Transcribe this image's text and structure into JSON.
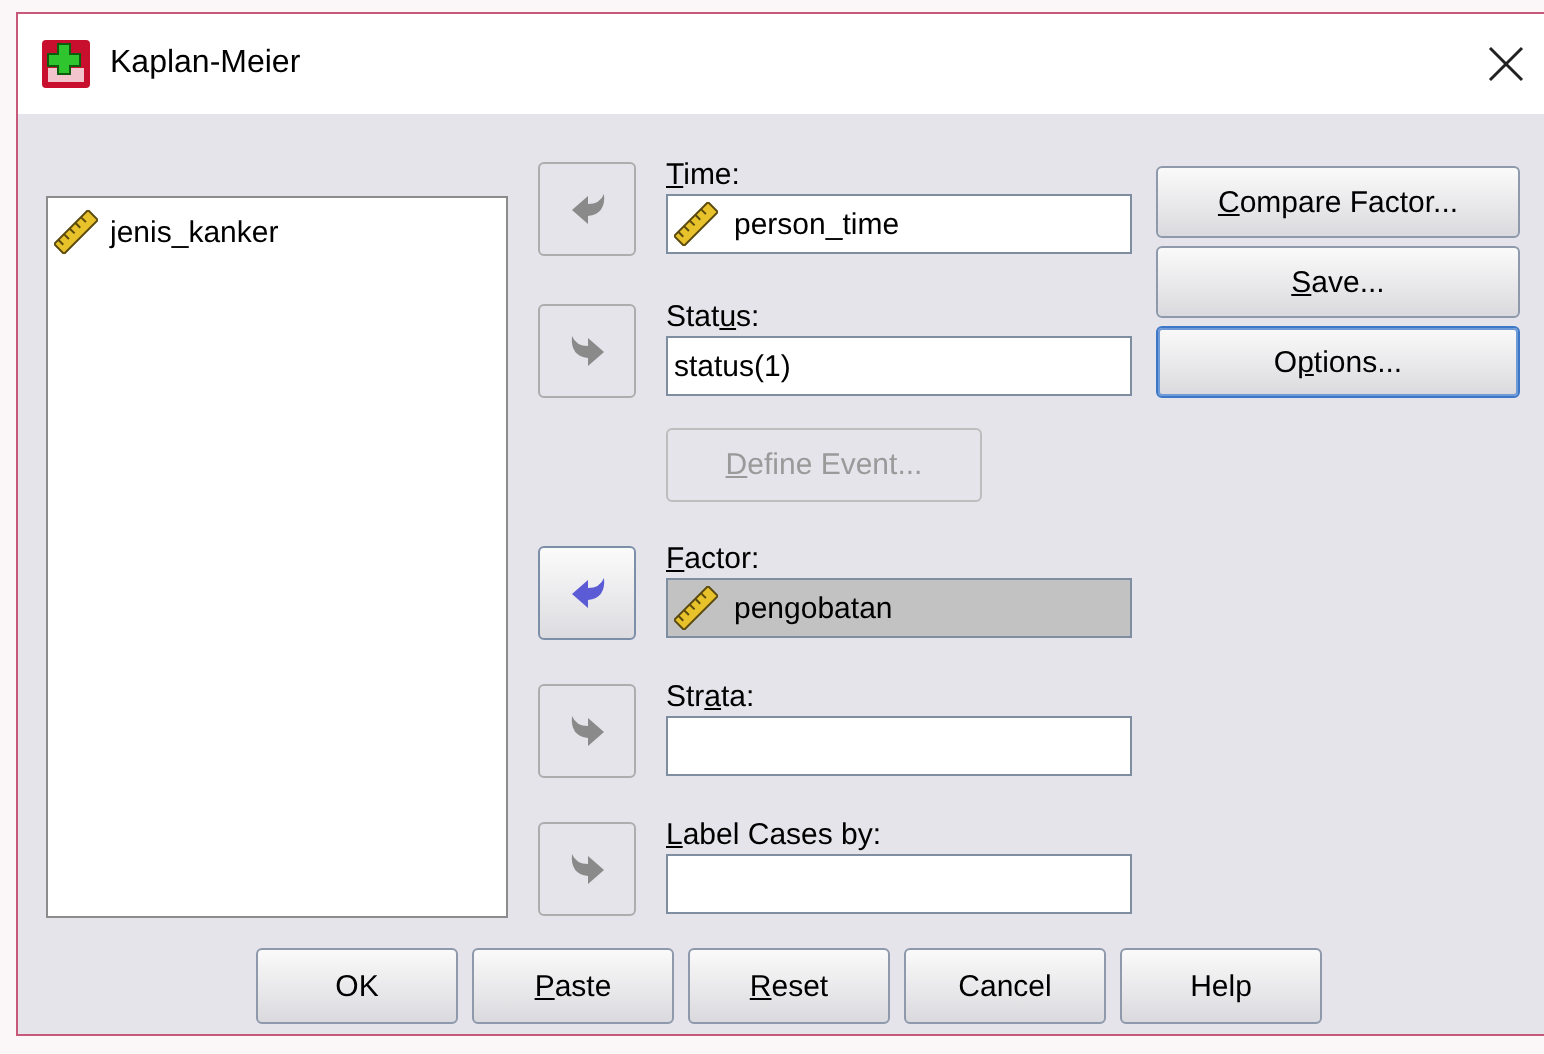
{
  "window": {
    "title": "Kaplan-Meier"
  },
  "source_list": {
    "items": [
      {
        "name": "jenis_kanker",
        "kind": "scale"
      }
    ]
  },
  "targets": [
    {
      "label": [
        {
          "text": "T",
          "underlined": true
        },
        {
          "text": "ime:",
          "underlined": false
        }
      ],
      "points_left": true,
      "arrow_active": false,
      "value": {
        "text": "person_time",
        "kind": "scale"
      },
      "selected": false
    },
    {
      "label": [
        {
          "text": "Stat",
          "underlined": false
        },
        {
          "text": "u",
          "underlined": true
        },
        {
          "text": "s:",
          "underlined": false
        }
      ],
      "points_left": false,
      "arrow_active": false,
      "value": {
        "text": "status(1)",
        "kind": "plain"
      },
      "selected": false,
      "button": {
        "label": [
          {
            "text": "D",
            "underlined": true
          },
          {
            "text": "efine Event...",
            "underlined": false
          }
        ],
        "disabled": true
      }
    },
    {
      "label": [
        {
          "text": "F",
          "underlined": true
        },
        {
          "text": "actor:",
          "underlined": false
        }
      ],
      "points_left": true,
      "arrow_active": true,
      "value": {
        "text": "pengobatan",
        "kind": "scale"
      },
      "selected": true
    },
    {
      "label": [
        {
          "text": "Str",
          "underlined": false
        },
        {
          "text": "a",
          "underlined": true
        },
        {
          "text": "ta:",
          "underlined": false
        }
      ],
      "points_left": false,
      "arrow_active": false,
      "selected": false
    },
    {
      "label": [
        {
          "text": "L",
          "underlined": true
        },
        {
          "text": "abel Cases by:",
          "underlined": false
        }
      ],
      "points_left": false,
      "arrow_active": false,
      "selected": false
    }
  ],
  "side_buttons": [
    {
      "label": [
        {
          "text": "C",
          "underlined": true
        },
        {
          "text": "ompare Factor...",
          "underlined": false
        }
      ],
      "focused": false
    },
    {
      "label": [
        {
          "text": "S",
          "underlined": true
        },
        {
          "text": "ave...",
          "underlined": false
        }
      ],
      "focused": false
    },
    {
      "label": [
        {
          "text": "O",
          "underlined": false
        },
        {
          "text": "p",
          "underlined": true
        },
        {
          "text": "tions...",
          "underlined": false
        }
      ],
      "focused": true
    }
  ],
  "bottom_buttons": [
    {
      "label": [
        {
          "text": "OK",
          "underlined": false
        }
      ]
    },
    {
      "label": [
        {
          "text": "P",
          "underlined": true
        },
        {
          "text": "aste",
          "underlined": false
        }
      ]
    },
    {
      "label": [
        {
          "text": "R",
          "underlined": true
        },
        {
          "text": "eset",
          "underlined": false
        }
      ]
    },
    {
      "label": [
        {
          "text": "Cancel",
          "underlined": false
        }
      ]
    },
    {
      "label": [
        {
          "text": "Help",
          "underlined": false
        }
      ]
    }
  ]
}
